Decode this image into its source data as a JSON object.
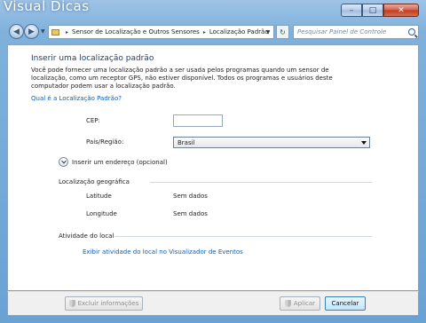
{
  "watermark": "Visual Dicas",
  "window": {
    "minimize_glyph": "–",
    "maximize_glyph": "□",
    "close_glyph": "✕"
  },
  "nav": {
    "back_glyph": "◀",
    "forward_glyph": "▶",
    "refresh_glyph": "↻",
    "breadcrumbs": [
      "Sensor de Localização e Outros Sensores",
      "Localização Padrão"
    ],
    "search_placeholder": "Pesquisar Painel de Controle"
  },
  "page": {
    "title": "Inserir uma localização padrão",
    "description": "Você pode fornecer uma localização padrão a ser usada pelos programas quando um sensor de localização, como um receptor GPS, não estiver disponível. Todos os programas e usuários deste computador podem usar a localização padrão.",
    "help_link": "Qual é a Localização Padrão?",
    "form": {
      "cep_label": "CEP:",
      "cep_value": "",
      "country_label": "País/Região:",
      "country_value": "Brasil"
    },
    "expander_label": "Inserir um endereço (opcional)",
    "geo_section": {
      "title": "Localização geográfica",
      "latitude_label": "Latitude",
      "latitude_value": "Sem dados",
      "longitude_label": "Longitude",
      "longitude_value": "Sem dados"
    },
    "activity_section": {
      "title": "Atividade do local",
      "link": "Exibir atividade do local no Visualizador de Eventos"
    }
  },
  "footer": {
    "clear_button": "Excluir informações",
    "apply_button": "Aplicar",
    "cancel_button": "Cancelar"
  },
  "colors": {
    "link": "#0e5fbc",
    "title": "#1e3f6c",
    "accent_border": "#3c7fb1"
  }
}
